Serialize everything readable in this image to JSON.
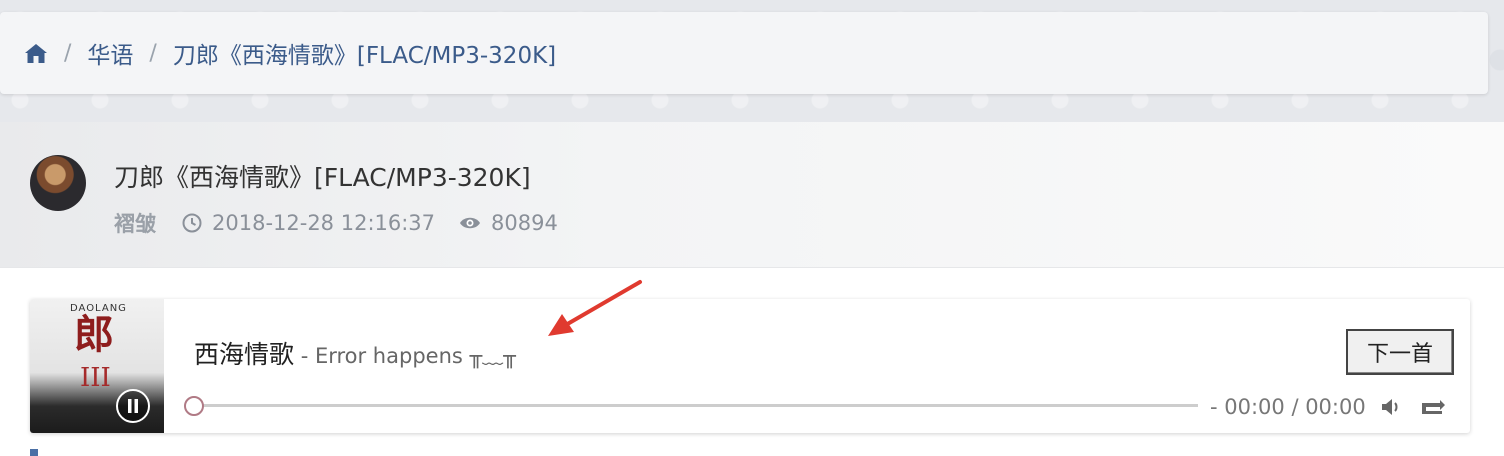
{
  "breadcrumb": {
    "home_icon": "home-icon",
    "items": [
      "华语",
      "刀郎《西海情歌》[FLAC/MP3-320K]"
    ],
    "separator": "/"
  },
  "post": {
    "title": "刀郎《西海情歌》[FLAC/MP3-320K]",
    "author": "褶皱",
    "date": "2018-12-28 12:16:37",
    "views": "80894"
  },
  "player": {
    "song_title": "西海情歌",
    "error_text": " - Error happens ╥﹏╥",
    "next_label": "下一首",
    "time_text": "- 00:00 / 00:00",
    "cover_text_top": "DAOLANG",
    "cover_char": "郎",
    "cover_roman": "III",
    "progress": 0
  },
  "colors": {
    "link": "#3b5b8a",
    "arrow": "#e03a2f",
    "knob_border": "#b07a85"
  }
}
